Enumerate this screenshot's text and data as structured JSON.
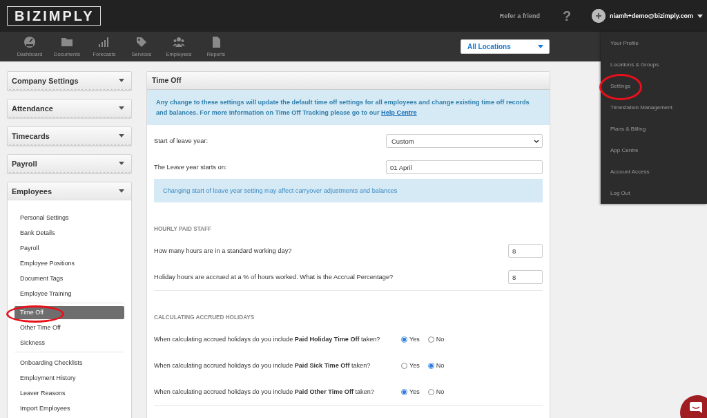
{
  "header": {
    "logo": "BIZIMPLY",
    "refer_link": "Refer a friend",
    "help": "?",
    "user_email": "niamh+demo@bizimply.com"
  },
  "nav": {
    "items": [
      {
        "label": "Dashboard",
        "kind": "gauge"
      },
      {
        "label": "Documents",
        "kind": "folder"
      },
      {
        "label": "Forecasts",
        "kind": "bars"
      },
      {
        "label": "Services",
        "kind": "tag"
      },
      {
        "label": "Employees",
        "kind": "people"
      },
      {
        "label": "Reports",
        "kind": "document"
      }
    ],
    "location_select": "All Locations"
  },
  "user_menu": {
    "items": [
      {
        "label": "Your Profile",
        "circled": false
      },
      {
        "label": "Locations & Groups",
        "circled": false
      },
      {
        "label": "Settings",
        "circled": true
      },
      {
        "label": "Timestation Management",
        "circled": false
      },
      {
        "label": "Plans & Billing",
        "circled": false
      },
      {
        "label": "App Centre",
        "circled": false
      },
      {
        "label": "Account Access",
        "circled": false
      },
      {
        "label": "Log Out",
        "circled": false
      }
    ]
  },
  "sidebar": {
    "sections": [
      {
        "label": "Company Settings",
        "expanded": false
      },
      {
        "label": "Attendance",
        "expanded": false
      },
      {
        "label": "Timecards",
        "expanded": false
      },
      {
        "label": "Payroll",
        "expanded": false
      },
      {
        "label": "Employees",
        "expanded": true,
        "groups": [
          {
            "items": [
              {
                "label": "Personal Settings",
                "selected": false,
                "circled": false
              },
              {
                "label": "Bank Details",
                "selected": false,
                "circled": false
              },
              {
                "label": "Payroll",
                "selected": false,
                "circled": false
              },
              {
                "label": "Employee Positions",
                "selected": false,
                "circled": false
              },
              {
                "label": "Document Tags",
                "selected": false,
                "circled": false
              },
              {
                "label": "Employee Training",
                "selected": false,
                "circled": false
              }
            ]
          },
          {
            "items": [
              {
                "label": "Time Off",
                "selected": true,
                "circled": true
              },
              {
                "label": "Other Time Off",
                "selected": false,
                "circled": false
              },
              {
                "label": "Sickness",
                "selected": false,
                "circled": false
              }
            ]
          },
          {
            "items": [
              {
                "label": "Onboarding Checklists",
                "selected": false,
                "circled": false
              },
              {
                "label": "Employment History",
                "selected": false,
                "circled": false
              },
              {
                "label": "Leaver Reasons",
                "selected": false,
                "circled": false
              },
              {
                "label": "Import Employees",
                "selected": false,
                "circled": false
              }
            ]
          }
        ]
      }
    ]
  },
  "panel": {
    "title": "Time Off",
    "notice": {
      "text": "Any change to these settings will update the default time off settings for all employees and change existing time off records and balances. For more Information on Time Off Tracking please go to our",
      "link": "Help Centre"
    },
    "fields": [
      {
        "kind": "select",
        "label": "Start of leave year:",
        "value": "Custom"
      },
      {
        "kind": "text",
        "label": "The Leave year starts on:",
        "value": "01 April"
      }
    ],
    "field_note": "Changing start of leave year setting may affect carryover adjustments and balances",
    "sections": [
      {
        "heading": "HOURLY PAID STAFF",
        "rows": [
          {
            "kind": "number",
            "label": "How many hours are in a standard working day?",
            "value": "8"
          },
          {
            "kind": "number",
            "label": "Holiday hours are accrued at a % of hours worked. What is the Accrual Percentage?",
            "value": "8"
          }
        ]
      },
      {
        "heading": "CALCULATING ACCRUED HOLIDAYS",
        "rows": [
          {
            "kind": "radio",
            "label": "When calculating accrued holidays do you include **Paid Holiday Time Off** taken?",
            "options": [
              {
                "label": "Yes",
                "selected": true
              },
              {
                "label": "No",
                "selected": false
              }
            ]
          },
          {
            "kind": "radio",
            "label": "When calculating accrued holidays do you include **Paid Sick Time Off** taken?",
            "options": [
              {
                "label": "Yes",
                "selected": false
              },
              {
                "label": "No",
                "selected": true
              }
            ]
          },
          {
            "kind": "radio",
            "label": "When calculating accrued holidays do you include **Paid Other Time Off** taken?",
            "options": [
              {
                "label": "Yes",
                "selected": true
              },
              {
                "label": "No",
                "selected": false
              }
            ]
          }
        ]
      }
    ]
  }
}
